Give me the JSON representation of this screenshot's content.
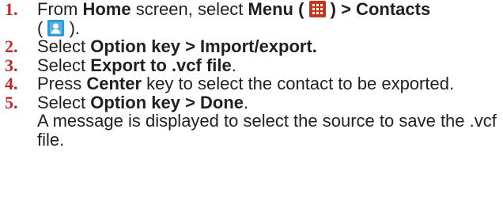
{
  "steps": [
    {
      "number": "1.",
      "parts": {
        "a": "From ",
        "home": "Home",
        "b": " screen, select ",
        "menu": "Menu",
        "open_paren": " ( ",
        "close_paren_arrow": " ) > Contacts",
        "line2_open": "( ",
        "line2_close": " )."
      },
      "icons": [
        "menu-grid-icon",
        "contacts-person-icon"
      ]
    },
    {
      "number": "2.",
      "parts": {
        "a": "Select ",
        "bold": "Option key > Import/export."
      }
    },
    {
      "number": "3.",
      "parts": {
        "a": "Select ",
        "bold": "Export to .vcf file",
        "b": "."
      }
    },
    {
      "number": "4.",
      "parts": {
        "a": "Press ",
        "bold": "Center",
        "b": " key to select the contact to be exported."
      }
    },
    {
      "number": "5.",
      "parts": {
        "a": "Select ",
        "bold": "Option key > Done",
        "b": "."
      },
      "note": "A message is displayed to select the source to save the .vcf file."
    }
  ],
  "colors": {
    "number": "#c0282d",
    "text": "#231f20",
    "menu_icon": "#c8351a",
    "contacts_icon": "#2f9ad6"
  }
}
